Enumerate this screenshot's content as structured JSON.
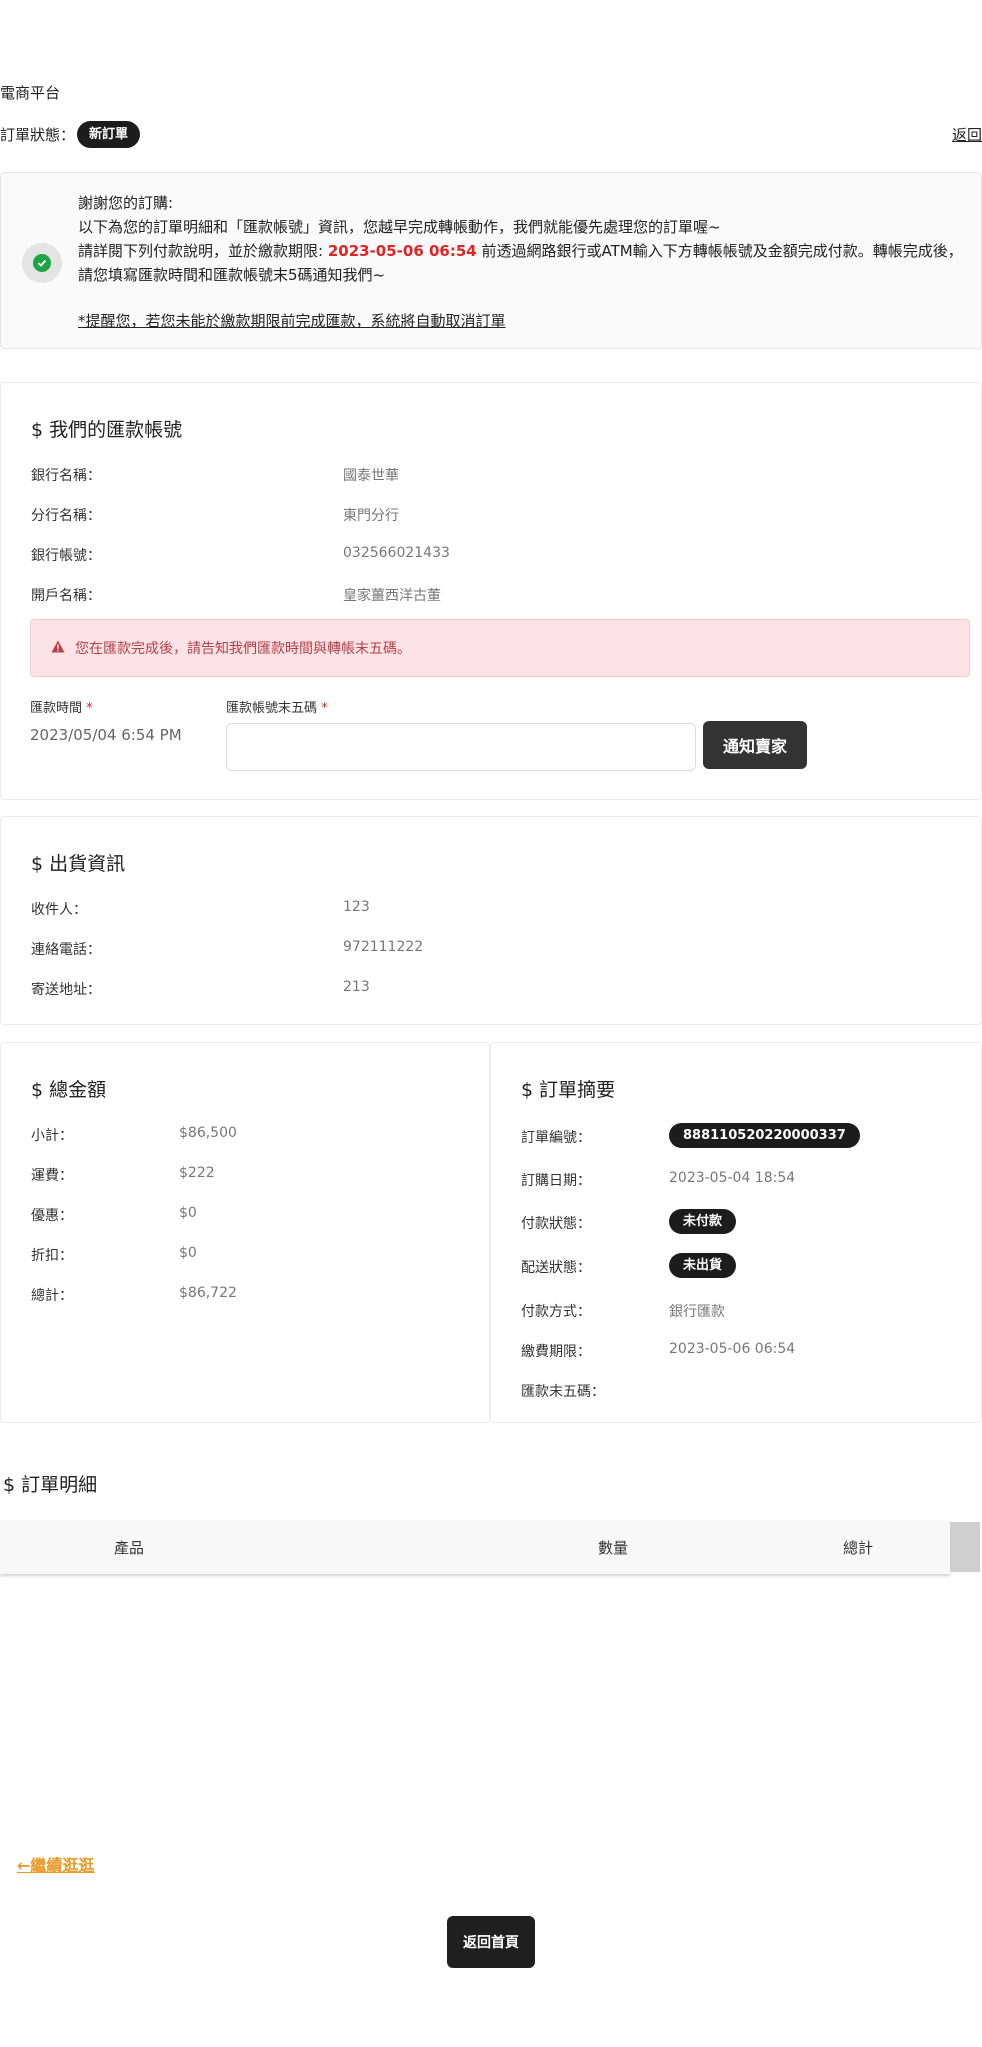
{
  "header": {
    "brand": "電商平台",
    "status_label": "訂單狀態：",
    "status_badge": "新訂單",
    "back_link": "返回"
  },
  "notice": {
    "line1": "謝謝您的訂購:",
    "line2": "以下為您的訂單明細和「匯款帳號」資訊，您越早完成轉帳動作，我們就能優先處理您的訂單喔~",
    "line3_prefix": "請詳閱下列付款說明，並於繳款期限: ",
    "deadline": "2023-05-06 06:54",
    "line3_suffix": " 前透過網路銀行或ATM輸入下方轉帳帳號及金額完成付款。轉帳完成後，請您填寫匯款時間和匯款帳號末5碼通知我們~",
    "warning": "*提醒您，若您未能於繳款期限前完成匯款，系統將自動取消訂單"
  },
  "remittance": {
    "title": "$ 我們的匯款帳號",
    "rows": [
      {
        "label": "銀行名稱：",
        "value": "國泰世華"
      },
      {
        "label": "分行名稱：",
        "value": "東門分行"
      },
      {
        "label": "銀行帳號：",
        "value": "032566021433"
      },
      {
        "label": "開戶名稱：",
        "value": "皇家薑西洋古董"
      }
    ],
    "alert": "您在匯款完成後，請告知我們匯款時間與轉帳末五碼。",
    "time_label": "匯款時間",
    "time_value": "2023/05/04 6:54 PM",
    "tail_label": "匯款帳號末五碼",
    "required_mark": "*",
    "tail_value": "",
    "notify_button": "通知賣家"
  },
  "shipping": {
    "title": "$ 出貨資訊",
    "rows": [
      {
        "label": "收件人：",
        "value": "123"
      },
      {
        "label": "連絡電話：",
        "value": "972111222"
      },
      {
        "label": "寄送地址：",
        "value": "213"
      }
    ]
  },
  "total": {
    "title": "$ 總金額",
    "rows": [
      {
        "label": "小計：",
        "value": "$86,500"
      },
      {
        "label": "運費：",
        "value": "$222"
      },
      {
        "label": "優惠：",
        "value": "$0"
      },
      {
        "label": "折扣：",
        "value": "$0"
      },
      {
        "label": "總計：",
        "value": "$86,722"
      }
    ]
  },
  "summary": {
    "title": "$ 訂單摘要",
    "order_no_label": "訂單編號：",
    "order_no": "888110520220000337",
    "date_label": "訂購日期：",
    "date_value": "2023-05-04 18:54",
    "pay_status_label": "付款狀態：",
    "pay_status": "未付款",
    "ship_status_label": "配送狀態：",
    "ship_status": "未出貨",
    "pay_method_label": "付款方式：",
    "pay_method": "銀行匯款",
    "deadline_label": "繳費期限：",
    "deadline_value": "2023-05-06 06:54",
    "tail_label": "匯款末五碼：",
    "tail_value": ""
  },
  "details": {
    "title": "$ 訂單明細",
    "columns": [
      "產品",
      "數量",
      "總計"
    ]
  },
  "footer": {
    "continue_link": "繼續逛逛",
    "home_button": "返回首頁"
  }
}
